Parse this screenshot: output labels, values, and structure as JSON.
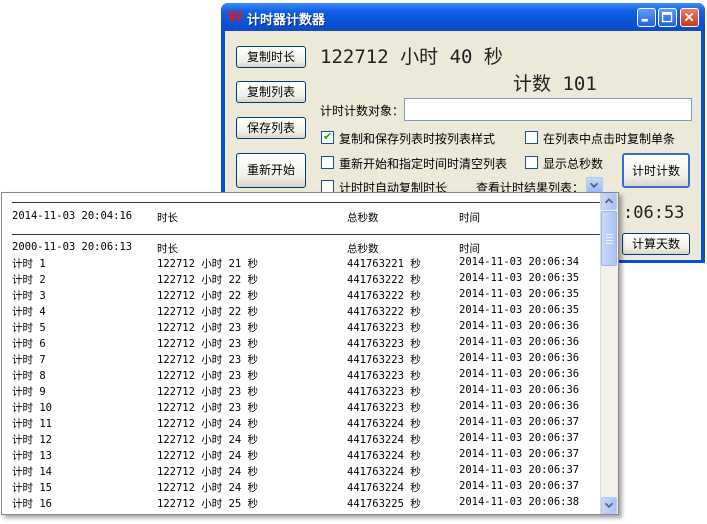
{
  "window": {
    "title": "计时器计数器",
    "app_icon": "w-logo-icon",
    "accent_color": "#0a52d8"
  },
  "buttons": {
    "copy_duration": "复制时长",
    "copy_list": "复制列表",
    "save_list": "保存列表",
    "restart": "重新开始",
    "count": "计时计数",
    "calc_days": "计算天数"
  },
  "display": {
    "elapsed_num": "122712",
    "elapsed_unit_hours": "小时",
    "elapsed_minutes": "40",
    "elapsed_unit_seconds": "秒",
    "count_label": "计数",
    "count_value": "101",
    "clock_partial": ":06:53"
  },
  "target": {
    "label": "计时计数对象：",
    "value": ""
  },
  "options": [
    {
      "label": "复制和保存列表时按列表样式",
      "checked": true
    },
    {
      "label": "在列表中点击时复制单条",
      "checked": false
    },
    {
      "label": "重新开始和指定时间时清空列表",
      "checked": false
    },
    {
      "label": "显示总秒数",
      "checked": false
    },
    {
      "label": "计时时自动复制时长",
      "checked": false
    }
  ],
  "view_results_label": "查看计时结果列表：",
  "list": {
    "session_header": {
      "c1": "2014-11-03 20:04:16",
      "c2": "时长",
      "c3": "总秒数",
      "c4": "时间"
    },
    "columns_header": {
      "c1": "2000-11-03 20:06:13",
      "c2": "时长",
      "c3": "总秒数",
      "c4": "时间"
    },
    "rows": [
      {
        "name": "计时 1",
        "duration": "122712 小时 21 秒",
        "total": "441763221 秒",
        "time": "2014-11-03 20:06:34"
      },
      {
        "name": "计时 2",
        "duration": "122712 小时 22 秒",
        "total": "441763222 秒",
        "time": "2014-11-03 20:06:35"
      },
      {
        "name": "计时 3",
        "duration": "122712 小时 22 秒",
        "total": "441763222 秒",
        "time": "2014-11-03 20:06:35"
      },
      {
        "name": "计时 4",
        "duration": "122712 小时 22 秒",
        "total": "441763222 秒",
        "time": "2014-11-03 20:06:35"
      },
      {
        "name": "计时 5",
        "duration": "122712 小时 23 秒",
        "total": "441763223 秒",
        "time": "2014-11-03 20:06:36"
      },
      {
        "name": "计时 6",
        "duration": "122712 小时 23 秒",
        "total": "441763223 秒",
        "time": "2014-11-03 20:06:36"
      },
      {
        "name": "计时 7",
        "duration": "122712 小时 23 秒",
        "total": "441763223 秒",
        "time": "2014-11-03 20:06:36"
      },
      {
        "name": "计时 8",
        "duration": "122712 小时 23 秒",
        "total": "441763223 秒",
        "time": "2014-11-03 20:06:36"
      },
      {
        "name": "计时 9",
        "duration": "122712 小时 23 秒",
        "total": "441763223 秒",
        "time": "2014-11-03 20:06:36"
      },
      {
        "name": "计时 10",
        "duration": "122712 小时 23 秒",
        "total": "441763223 秒",
        "time": "2014-11-03 20:06:36"
      },
      {
        "name": "计时 11",
        "duration": "122712 小时 24 秒",
        "total": "441763224 秒",
        "time": "2014-11-03 20:06:37"
      },
      {
        "name": "计时 12",
        "duration": "122712 小时 24 秒",
        "total": "441763224 秒",
        "time": "2014-11-03 20:06:37"
      },
      {
        "name": "计时 13",
        "duration": "122712 小时 24 秒",
        "total": "441763224 秒",
        "time": "2014-11-03 20:06:37"
      },
      {
        "name": "计时 14",
        "duration": "122712 小时 24 秒",
        "total": "441763224 秒",
        "time": "2014-11-03 20:06:37"
      },
      {
        "name": "计时 15",
        "duration": "122712 小时 24 秒",
        "total": "441763224 秒",
        "time": "2014-11-03 20:06:37"
      },
      {
        "name": "计时 16",
        "duration": "122712 小时 25 秒",
        "total": "441763225 秒",
        "time": "2014-11-03 20:06:38"
      }
    ]
  }
}
